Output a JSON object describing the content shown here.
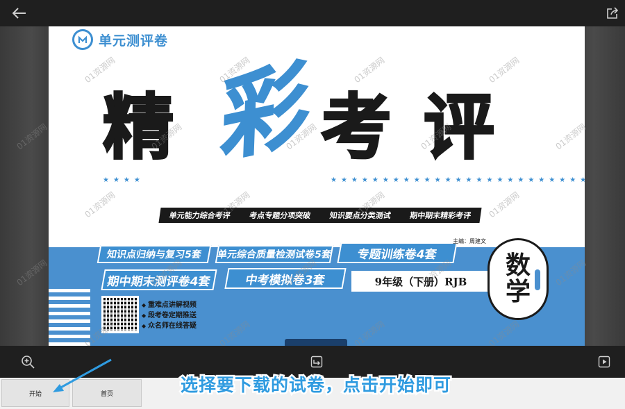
{
  "toolbar_top": {
    "back_icon": "arrow-left-icon",
    "share_icon": "share-icon"
  },
  "cover": {
    "brand": "单元测评卷",
    "title_chars": [
      "精",
      "彩",
      "考",
      "评"
    ],
    "stars": "★★★★",
    "stars_long": "★★★★★★★★★★★★★★★★★★★★★★★★★★★★★★★★★★",
    "features": [
      "单元能力综合考评",
      "考点专题分项突破",
      "知识要点分类测试",
      "期中期末精彩考评"
    ],
    "tags": [
      "知识点归纳与复习5套",
      "单元综合质量检测试卷5套",
      "专题训练卷4套",
      "期中期末测评卷4套",
      "中考模拟卷3套"
    ],
    "author": "主编：周建文",
    "grade": "9年级（下册）RJB",
    "subject": [
      "数",
      "学"
    ],
    "bullets": [
      "重难点讲解视频",
      "段考卷定期推送",
      "众名师在线答疑"
    ],
    "watermark": "01资源网"
  },
  "toolbar_bottom": {
    "zoom_icon": "zoom-in-icon",
    "rotate_icon": "rotate-icon",
    "slideshow_icon": "slideshow-icon"
  },
  "taskbar": {
    "start_label": "开始",
    "home_label": "首页"
  },
  "instruction": "选择要下载的试卷，点击开始即可",
  "colors": {
    "accent": "#3d8fd1",
    "band": "#4a90cf",
    "instruction": "#2f9be0"
  }
}
